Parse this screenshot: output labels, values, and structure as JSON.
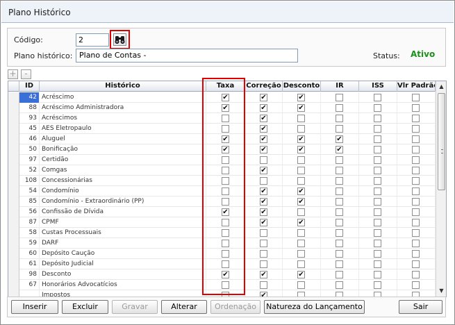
{
  "window": {
    "title": "Plano Histórico"
  },
  "form": {
    "codigo_label": "Código:",
    "codigo_value": "2",
    "plano_label": "Plano histórico:",
    "plano_value": "Plano de Contas -",
    "status_label": "Status:",
    "status_value": "Ativo",
    "search_icon": "binoculars-icon"
  },
  "toolbar": {
    "add_label": "+",
    "remove_label": "-"
  },
  "grid": {
    "columns": [
      {
        "key": "sel",
        "label": ""
      },
      {
        "key": "id",
        "label": "ID"
      },
      {
        "key": "historico",
        "label": "Histórico"
      },
      {
        "key": "taxa",
        "label": "Taxa"
      },
      {
        "key": "correcao",
        "label": "Correção"
      },
      {
        "key": "desconto",
        "label": "Desconto"
      },
      {
        "key": "ir",
        "label": "IR"
      },
      {
        "key": "iss",
        "label": "ISS"
      },
      {
        "key": "vlr_padrao",
        "label": "Vlr Padrão"
      }
    ],
    "rows": [
      {
        "id": "42",
        "historico": "Acréscimo",
        "taxa": true,
        "correcao": true,
        "desconto": true,
        "ir": false,
        "iss": false,
        "vlr_padrao": false,
        "selected": true
      },
      {
        "id": "88",
        "historico": "Acréscimo Administradora",
        "taxa": true,
        "correcao": true,
        "desconto": true,
        "ir": false,
        "iss": false,
        "vlr_padrao": false
      },
      {
        "id": "93",
        "historico": "Acréscimos",
        "taxa": false,
        "correcao": true,
        "desconto": false,
        "ir": false,
        "iss": false,
        "vlr_padrao": false
      },
      {
        "id": "45",
        "historico": "AES Eletropaulo",
        "taxa": false,
        "correcao": true,
        "desconto": false,
        "ir": false,
        "iss": false,
        "vlr_padrao": false
      },
      {
        "id": "46",
        "historico": "Aluguel",
        "taxa": true,
        "correcao": true,
        "desconto": true,
        "ir": true,
        "iss": false,
        "vlr_padrao": false
      },
      {
        "id": "50",
        "historico": "Bonificação",
        "taxa": true,
        "correcao": true,
        "desconto": true,
        "ir": true,
        "iss": false,
        "vlr_padrao": false
      },
      {
        "id": "97",
        "historico": "Certidão",
        "taxa": false,
        "correcao": false,
        "desconto": false,
        "ir": false,
        "iss": false,
        "vlr_padrao": false
      },
      {
        "id": "52",
        "historico": "Comgas",
        "taxa": false,
        "correcao": true,
        "desconto": false,
        "ir": false,
        "iss": false,
        "vlr_padrao": false
      },
      {
        "id": "108",
        "historico": "Concessionárias",
        "taxa": false,
        "correcao": false,
        "desconto": false,
        "ir": false,
        "iss": false,
        "vlr_padrao": false
      },
      {
        "id": "54",
        "historico": "Condomínio",
        "taxa": false,
        "correcao": true,
        "desconto": true,
        "ir": false,
        "iss": false,
        "vlr_padrao": false
      },
      {
        "id": "85",
        "historico": "Condomínio - Extraordinário (PP)",
        "taxa": false,
        "correcao": true,
        "desconto": true,
        "ir": false,
        "iss": false,
        "vlr_padrao": false
      },
      {
        "id": "56",
        "historico": "Confissão de Dívida",
        "taxa": true,
        "correcao": true,
        "desconto": false,
        "ir": false,
        "iss": false,
        "vlr_padrao": false
      },
      {
        "id": "87",
        "historico": "CPMF",
        "taxa": false,
        "correcao": true,
        "desconto": true,
        "ir": false,
        "iss": false,
        "vlr_padrao": false
      },
      {
        "id": "58",
        "historico": "Custas Processuais",
        "taxa": false,
        "correcao": false,
        "desconto": false,
        "ir": false,
        "iss": false,
        "vlr_padrao": false
      },
      {
        "id": "59",
        "historico": "DARF",
        "taxa": false,
        "correcao": false,
        "desconto": false,
        "ir": false,
        "iss": false,
        "vlr_padrao": false
      },
      {
        "id": "60",
        "historico": "Depósito Caução",
        "taxa": false,
        "correcao": false,
        "desconto": false,
        "ir": false,
        "iss": false,
        "vlr_padrao": false
      },
      {
        "id": "61",
        "historico": "Depósito Judicial",
        "taxa": false,
        "correcao": false,
        "desconto": false,
        "ir": false,
        "iss": false,
        "vlr_padrao": false
      },
      {
        "id": "98",
        "historico": "Desconto",
        "taxa": true,
        "correcao": true,
        "desconto": true,
        "ir": false,
        "iss": false,
        "vlr_padrao": false
      },
      {
        "id": "67",
        "historico": "Honorários Advocatícios",
        "taxa": false,
        "correcao": false,
        "desconto": false,
        "ir": false,
        "iss": false,
        "vlr_padrao": false
      },
      {
        "id": "",
        "historico": "Impostos",
        "taxa": false,
        "correcao": true,
        "desconto": false,
        "ir": false,
        "iss": false,
        "vlr_padrao": false
      }
    ]
  },
  "buttons": {
    "inserir": "Inserir",
    "excluir": "Excluir",
    "gravar": "Gravar",
    "alterar": "Alterar",
    "ordenacao": "Ordenação",
    "natureza": "Natureza do Lançamento",
    "sair": "Sair"
  },
  "colors": {
    "status_active": "#1d8f1d",
    "highlight": "#e00000",
    "selected_row": "#3a6fd8"
  }
}
